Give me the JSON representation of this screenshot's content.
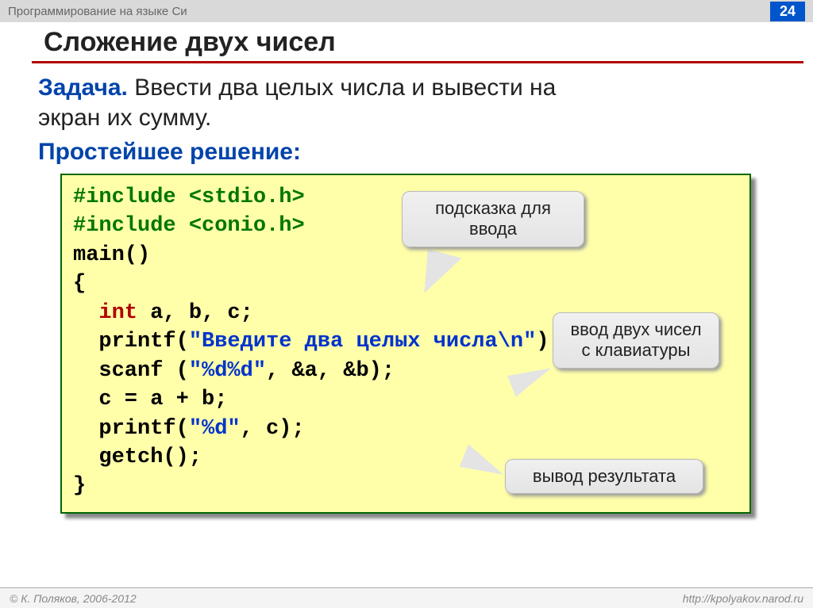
{
  "header": {
    "course": "Программирование на языке Си",
    "page": "24"
  },
  "title": "Сложение двух чисел",
  "task": {
    "label": "Задача.",
    "text_line1": " Ввести два целых числа и вывести на",
    "text_line2": "экран их сумму."
  },
  "solution_label": "Простейшее решение:",
  "code": {
    "inc1": "#include <stdio.h>",
    "inc2": "#include <conio.h>",
    "main": "main()",
    "brace_open": "{",
    "int_kw": "  int",
    "int_rest": " a, b, c;",
    "printf1_a": "  printf(",
    "printf1_str": "\"Введите два целых числа\\n\"",
    "printf1_b": ");",
    "scanf_a": "  scanf (",
    "scanf_str": "\"%d%d\"",
    "scanf_b": ", &a, &b);",
    "assign": "  c = a + b;",
    "printf2_a": "  printf(",
    "printf2_str": "\"%d\"",
    "printf2_b": ", c);",
    "getch": "  getch();",
    "brace_close": "}"
  },
  "callouts": {
    "c1": "подсказка для ввода",
    "c2": "ввод двух чисел с клавиатуры",
    "c3": "вывод результата"
  },
  "footer": {
    "copyright": "© К. Поляков, 2006-2012",
    "url": "http://kpolyakov.narod.ru"
  }
}
